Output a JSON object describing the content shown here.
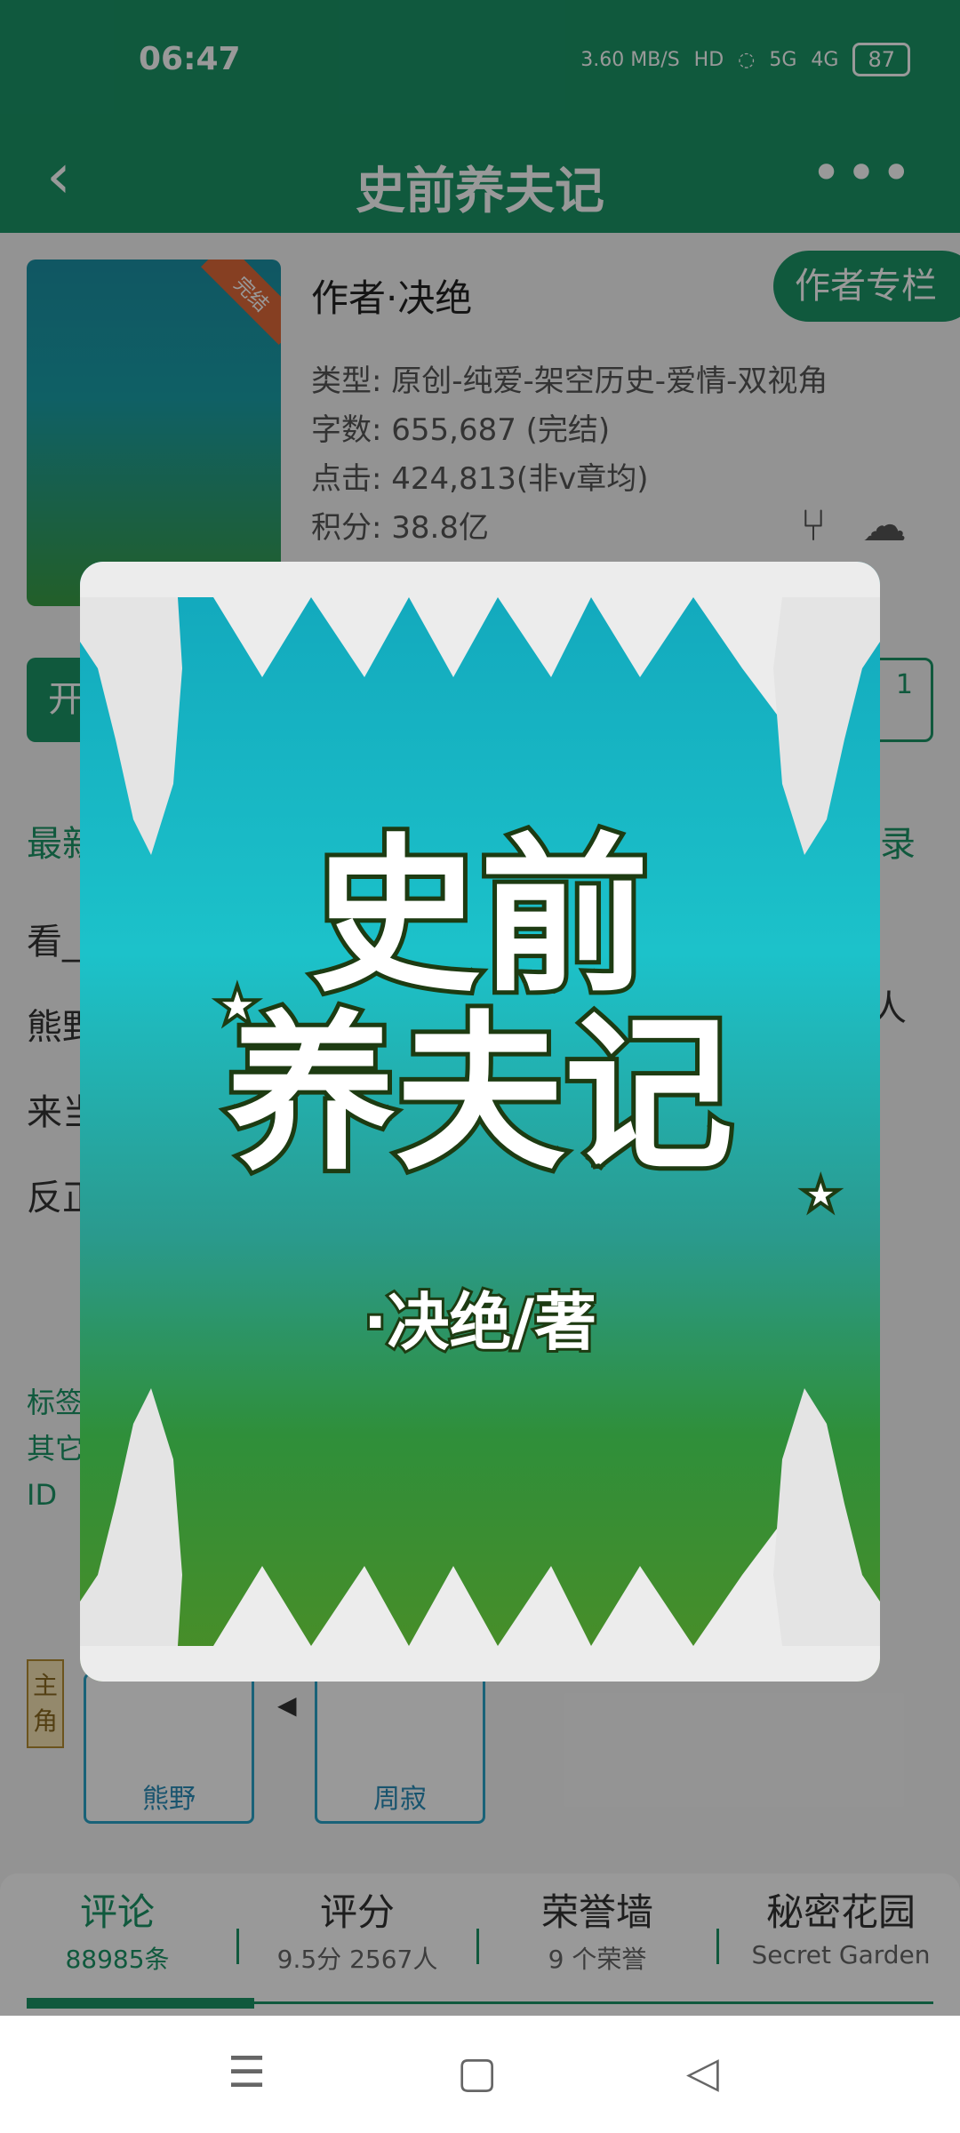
{
  "status_bar": {
    "time": "06:47",
    "net_speed": "3.60 MB/S",
    "hd": "HD",
    "signal_5g": "5G",
    "signal_4g": "4G",
    "battery": "87"
  },
  "app_bar": {
    "title": "史前养夫记"
  },
  "book": {
    "author_label": "作者·决绝",
    "author_column_button": "作者专栏",
    "completed_ribbon": "完结",
    "type": "类型: 原创-纯爱-架空历史-爱情-双视角",
    "word_count": "字数: 655,687 (完结)",
    "clicks": "点击: 424,813(非v章均)",
    "score": "积分: 38.8亿"
  },
  "partial": {
    "primary_button": "开",
    "outline_button_digit": "1",
    "latest": "最新",
    "catalog": "录",
    "intro_lines": [
      "看_",
      "熊野",
      "来当",
      "反正"
    ],
    "intro_right": "人",
    "tags": [
      "标签",
      "其它",
      "ID"
    ]
  },
  "roles": {
    "label": "主角",
    "cards": [
      {
        "name": "熊野"
      },
      {
        "name": "周寂"
      }
    ]
  },
  "stats_tabs": [
    {
      "label": "评论",
      "sub": "88985条"
    },
    {
      "label": "评分",
      "sub": "9.5分 2567人"
    },
    {
      "label": "荣誉墙",
      "sub": "9 个荣誉"
    },
    {
      "label": "秘密花园",
      "sub": "Secret Garden"
    }
  ],
  "cover": {
    "title_line1": "史前",
    "title_line2": "养夫记",
    "author": "·决绝/著"
  },
  "colors": {
    "brand": "#1b9567"
  }
}
